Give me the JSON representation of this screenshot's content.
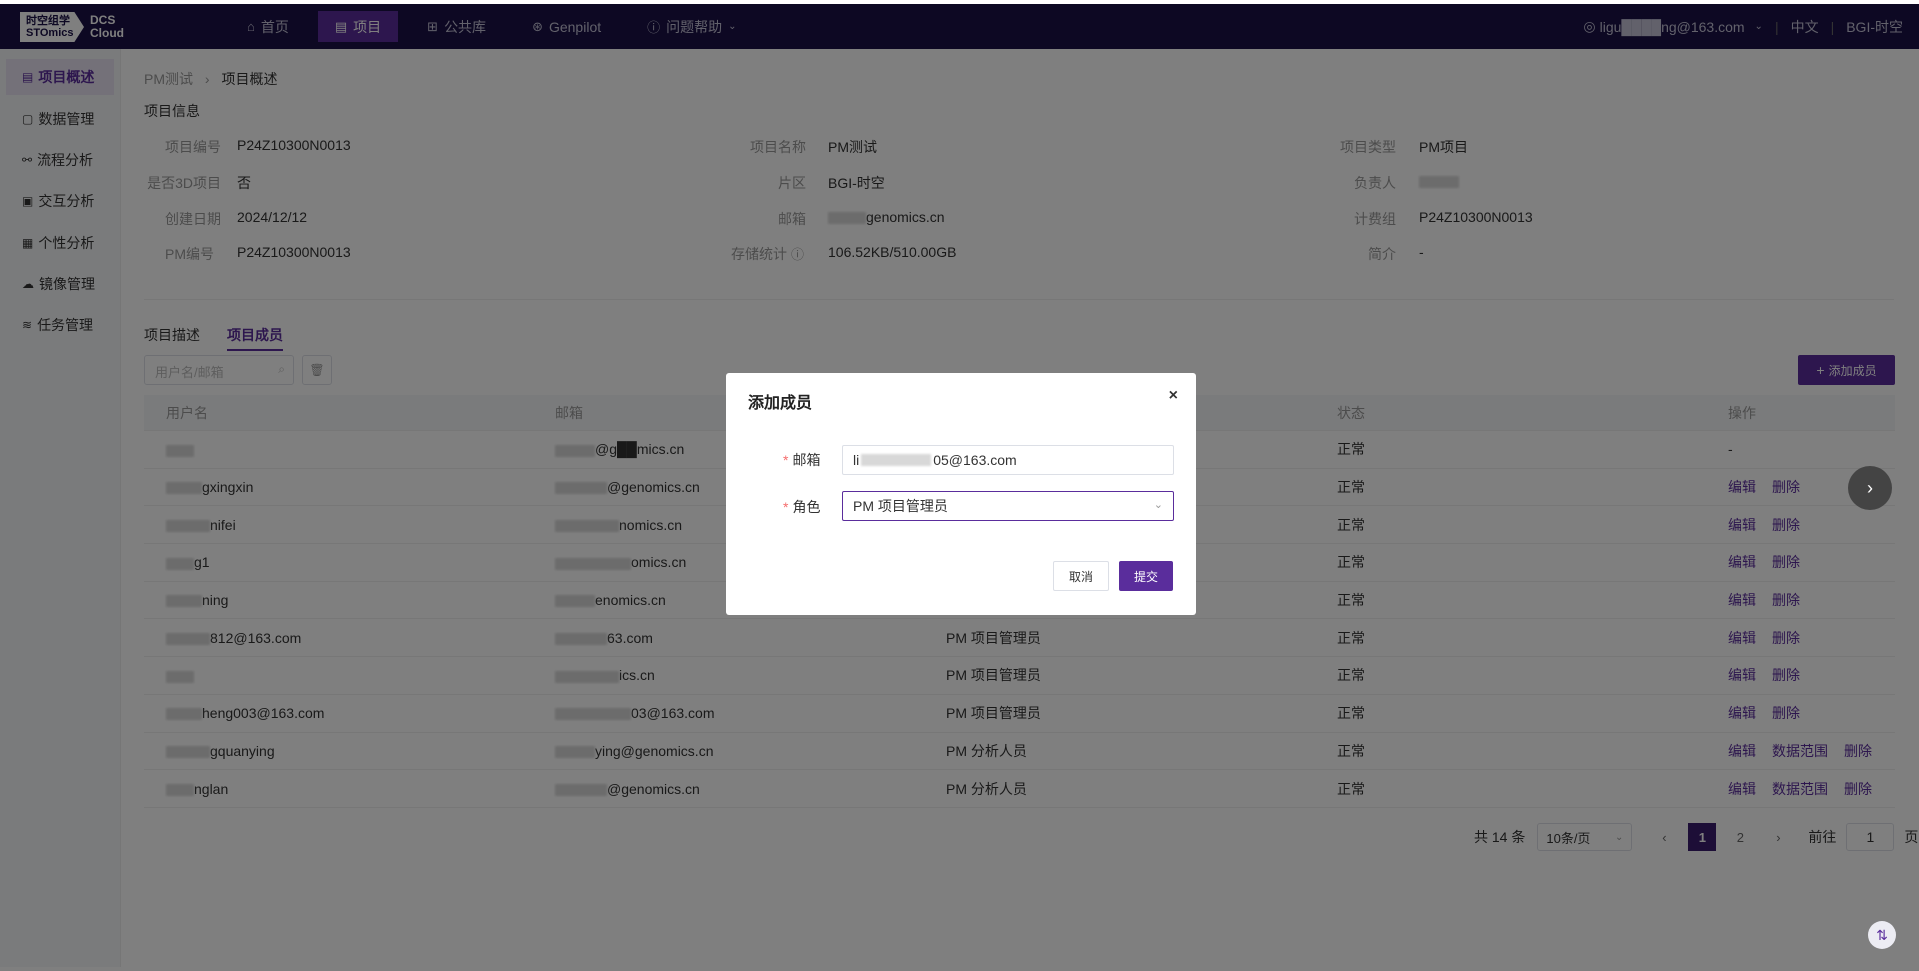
{
  "header": {
    "logo_cn": "时空组学",
    "logo_en": "STOmics",
    "logo_dcs": "DCS",
    "logo_cloud": "Cloud",
    "nav": [
      {
        "label": "首页",
        "icon": "home-icon"
      },
      {
        "label": "项目",
        "icon": "document-icon"
      },
      {
        "label": "公共库",
        "icon": "grid-icon"
      },
      {
        "label": "Genpilot",
        "icon": "genpilot-icon"
      },
      {
        "label": "问题帮助",
        "icon": "help-icon"
      }
    ],
    "user_email": "ligu████ng@163.com",
    "language": "中文",
    "org": "BGI-时空"
  },
  "sidebar": {
    "items": [
      {
        "label": "项目概述",
        "icon": "overview-icon"
      },
      {
        "label": "数据管理",
        "icon": "data-icon"
      },
      {
        "label": "流程分析",
        "icon": "workflow-icon"
      },
      {
        "label": "交互分析",
        "icon": "interactive-icon"
      },
      {
        "label": "个性分析",
        "icon": "personal-icon"
      },
      {
        "label": "镜像管理",
        "icon": "image-icon"
      },
      {
        "label": "任务管理",
        "icon": "task-icon"
      }
    ]
  },
  "breadcrumb": {
    "parent": "PM测试",
    "current": "项目概述"
  },
  "project_info": {
    "title": "项目信息",
    "fields": [
      {
        "label": "项目编号",
        "value": "P24Z10300N0013"
      },
      {
        "label": "项目名称",
        "value": "PM测试"
      },
      {
        "label": "项目类型",
        "value": "PM项目"
      },
      {
        "label": "是否3D项目",
        "value": "否"
      },
      {
        "label": "片区",
        "value": "BGI-时空"
      },
      {
        "label": "负责人",
        "value": ""
      },
      {
        "label": "创建日期",
        "value": "2024/12/12"
      },
      {
        "label": "邮箱",
        "value": "genomics.cn"
      },
      {
        "label": "计费组",
        "value": "P24Z10300N0013"
      },
      {
        "label": "PM编号",
        "value": "P24Z10300N0013"
      },
      {
        "label": "存储统计",
        "value": "106.52KB/510.00GB"
      },
      {
        "label": "简介",
        "value": "-"
      }
    ]
  },
  "tabs": [
    {
      "label": "项目描述"
    },
    {
      "label": "项目成员"
    }
  ],
  "search": {
    "placeholder": "用户名/邮箱"
  },
  "add_member_label": "添加成员",
  "table": {
    "headers": [
      "用户名",
      "邮箱",
      "",
      "状态",
      "操作"
    ],
    "rows": [
      {
        "user": "",
        "email": "@g██mics.cn",
        "role": "",
        "status": "正常",
        "ops": [
          "-"
        ]
      },
      {
        "user": "gxingxin",
        "email": "@genomics.cn",
        "role": "",
        "status": "正常",
        "ops": [
          "编辑",
          "删除"
        ]
      },
      {
        "user": "nifei",
        "email": "nomics.cn",
        "role": "",
        "status": "正常",
        "ops": [
          "编辑",
          "删除"
        ]
      },
      {
        "user": "g1",
        "email": "omics.cn",
        "role": "",
        "status": "正常",
        "ops": [
          "编辑",
          "删除"
        ]
      },
      {
        "user": "ning",
        "email": "enomics.cn",
        "role": "",
        "status": "正常",
        "ops": [
          "编辑",
          "删除"
        ]
      },
      {
        "user": "812@163.com",
        "email": "63.com",
        "role": "PM 项目管理员",
        "status": "正常",
        "ops": [
          "编辑",
          "删除"
        ]
      },
      {
        "user": "",
        "email": "ics.cn",
        "role": "PM 项目管理员",
        "status": "正常",
        "ops": [
          "编辑",
          "删除"
        ]
      },
      {
        "user": "heng003@163.com",
        "email": "03@163.com",
        "role": "PM 项目管理员",
        "status": "正常",
        "ops": [
          "编辑",
          "删除"
        ]
      },
      {
        "user": "gquanying",
        "email": "ying@genomics.cn",
        "role": "PM 分析人员",
        "status": "正常",
        "ops": [
          "编辑",
          "数据范围",
          "删除"
        ]
      },
      {
        "user": "nglan",
        "email": "@genomics.cn",
        "role": "PM 分析人员",
        "status": "正常",
        "ops": [
          "编辑",
          "数据范围",
          "删除"
        ]
      }
    ]
  },
  "pagination": {
    "total": "共 14 条",
    "page_size": "10条/页",
    "pages": [
      "1",
      "2"
    ],
    "goto_label": "前往",
    "goto_value": "1",
    "page_suffix": "页"
  },
  "modal": {
    "title": "添加成员",
    "email_label": "邮箱",
    "email_value_start": "li",
    "email_value_end": "05@163.com",
    "role_label": "角色",
    "role_value": "PM 项目管理员",
    "cancel": "取消",
    "submit": "提交"
  },
  "colors": {
    "brand": "#5a2d9c",
    "topbar": "#1a1147"
  }
}
